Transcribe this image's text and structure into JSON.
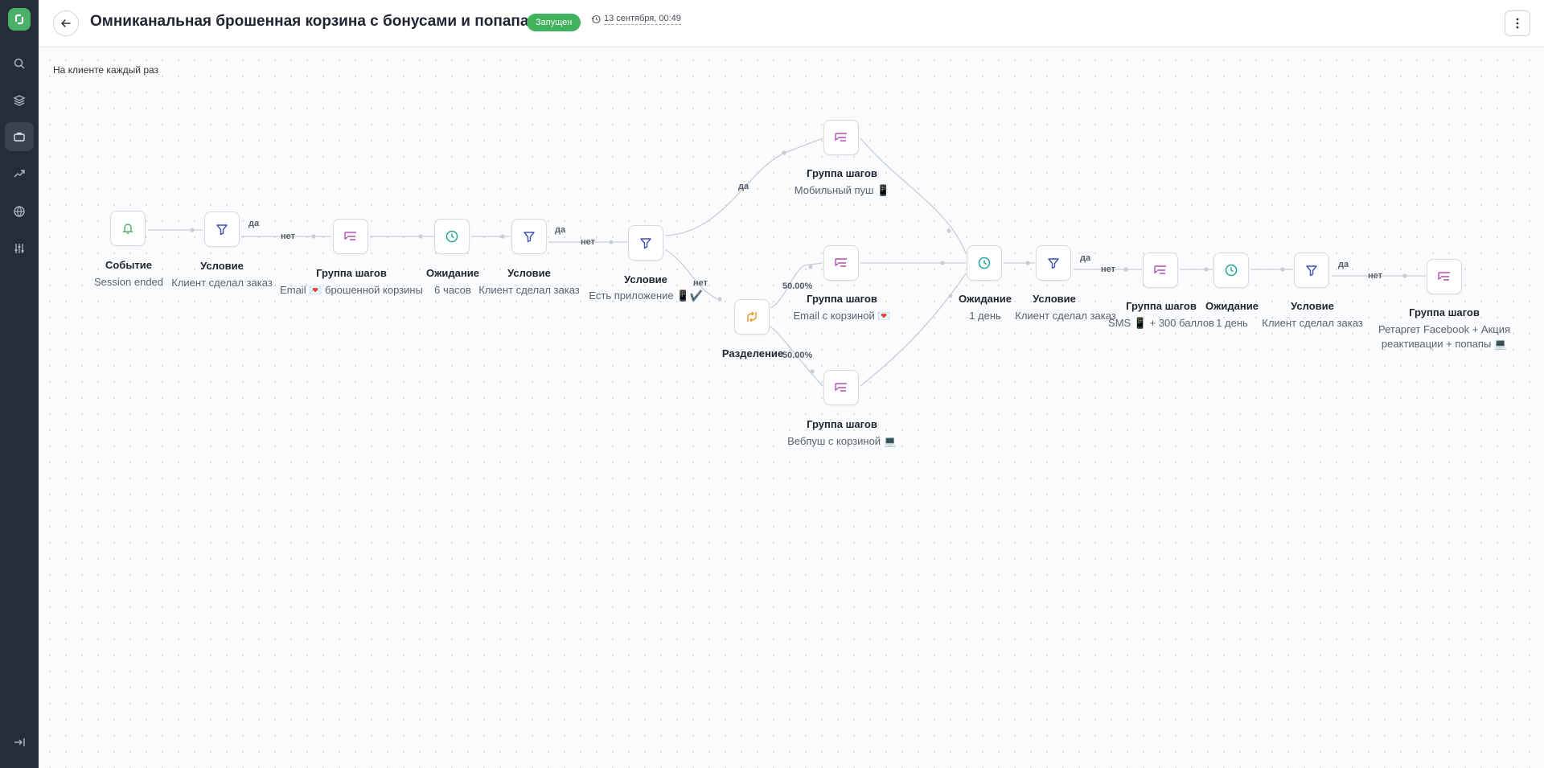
{
  "header": {
    "title": "Омниканальная брошенная корзина с бонусами и попапами",
    "status": "Запущен",
    "timestamp": "13 сентября, 00:49"
  },
  "canvas": {
    "mode_label": "На клиенте каждый раз"
  },
  "nodes": {
    "n1": {
      "title": "Событие",
      "subtitle": "Session ended"
    },
    "n2": {
      "title": "Условие",
      "subtitle": "Клиент сделал заказ"
    },
    "n3": {
      "title": "Группа шагов",
      "subtitle": "Email 💌 брошенной корзины"
    },
    "n4": {
      "title": "Ожидание",
      "subtitle": "6 часов"
    },
    "n5": {
      "title": "Условие",
      "subtitle": "Клиент сделал заказ"
    },
    "n6": {
      "title": "Условие",
      "subtitle": "Есть приложение 📱✔️"
    },
    "n7": {
      "title": "Разделение",
      "subtitle": ""
    },
    "n8": {
      "title": "Группа шагов",
      "subtitle": "Мобильный пуш 📱"
    },
    "n9": {
      "title": "Группа шагов",
      "subtitle": "Email с корзиной 💌"
    },
    "n10": {
      "title": "Группа шагов",
      "subtitle": "Вебпуш с корзиной 💻"
    },
    "n11": {
      "title": "Ожидание",
      "subtitle": "1 день"
    },
    "n12": {
      "title": "Условие",
      "subtitle": "Клиент сделал заказ"
    },
    "n13": {
      "title": "Группа шагов",
      "subtitle": "SMS 📱 + 300 баллов"
    },
    "n14": {
      "title": "Ожидание",
      "subtitle": "1 день"
    },
    "n15": {
      "title": "Условие",
      "subtitle": "Клиент сделал заказ"
    },
    "n16": {
      "title": "Группа шагов",
      "subtitle_line1": "Ретаргет Facebook + Акция",
      "subtitle_line2": "реактивации + попапы 💻"
    }
  },
  "edge_labels": {
    "yes": "да",
    "no": "нет",
    "split_a": "50.00%",
    "split_b": "50.00%"
  },
  "colors": {
    "brand": "#4caf6a",
    "status": "#3fb25b",
    "sidebar": "#272d38",
    "condition_icon": "#3f51b5",
    "group_icon": "#b04fb0",
    "wait_icon": "#20a39e",
    "event_icon": "#4caf6a",
    "split_icon": "#f0922b"
  },
  "icons": {
    "sidebar": [
      "search-icon",
      "layers-icon",
      "briefcase-icon",
      "trend-icon",
      "globe-icon",
      "sliders-icon",
      "collapse-icon"
    ],
    "nodes": [
      "bell-icon",
      "filter-icon",
      "steps-group-icon",
      "clock-icon",
      "split-icon"
    ]
  }
}
